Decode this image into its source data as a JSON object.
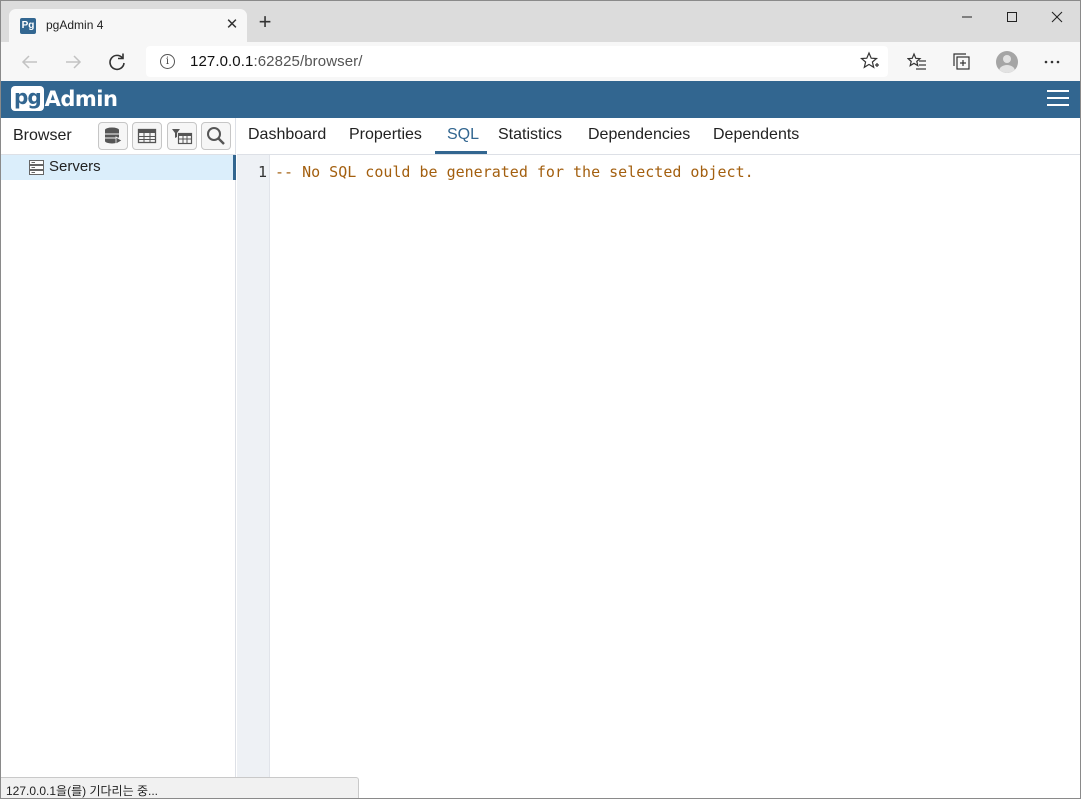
{
  "window": {
    "tab_title": "pgAdmin 4",
    "tab_favicon": "Pg",
    "new_tab_glyph": "+",
    "close_tab_glyph": "✕"
  },
  "address": {
    "host": "127.0.0.1",
    "rest": ":62825/browser/",
    "info_glyph": "i"
  },
  "app": {
    "logo_pg": "pg",
    "logo_admin": "Admin",
    "brand_color": "#326690"
  },
  "browser_panel": {
    "title": "Browser",
    "tree": [
      {
        "label": "Servers",
        "icon": "servers-icon"
      }
    ]
  },
  "main": {
    "tabs": [
      {
        "label": "Dashboard"
      },
      {
        "label": "Properties"
      },
      {
        "label": "SQL"
      },
      {
        "label": "Statistics"
      },
      {
        "label": "Dependencies"
      },
      {
        "label": "Dependents"
      }
    ],
    "active_tab": "SQL",
    "editor": {
      "line_number": "1",
      "line_text": "-- No SQL could be generated for the selected object.",
      "comment_color": "#a35f0f"
    }
  },
  "status": {
    "text": "127.0.0.1을(를) 기다리는 중..."
  }
}
